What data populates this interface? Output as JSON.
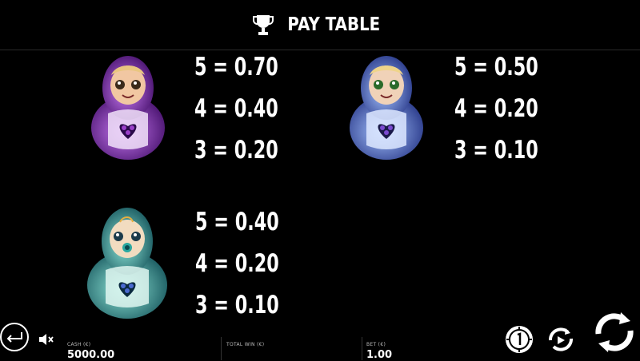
{
  "header": {
    "title": "PAY TABLE",
    "icon": "trophy-icon"
  },
  "symbols": [
    {
      "name": "purple-doll",
      "body_color": "#9a3fc9",
      "face_color": "#f2c8a0",
      "payouts": [
        "5 = 0.70",
        "4 = 0.40",
        "3 = 0.20"
      ]
    },
    {
      "name": "blue-doll",
      "body_color": "#5a7fd6",
      "face_color": "#f0d2b8",
      "payouts": [
        "5 = 0.50",
        "4 = 0.20",
        "3 = 0.10"
      ]
    },
    {
      "name": "teal-doll",
      "body_color": "#3fa8a0",
      "face_color": "#f2dcc0",
      "payouts": [
        "5 = 0.40",
        "4 = 0.20",
        "3 = 0.10"
      ]
    }
  ],
  "footer": {
    "cash_label": "CASH (€)",
    "cash_value": "5000.00",
    "total_win_label": "TOTAL WIN (€)",
    "bet_label": "BET (€)",
    "bet_value": "1.00",
    "icons": [
      "back-arrow-icon",
      "sound-mute-icon",
      "coin-icon",
      "autoplay-icon",
      "spin-icon"
    ]
  }
}
